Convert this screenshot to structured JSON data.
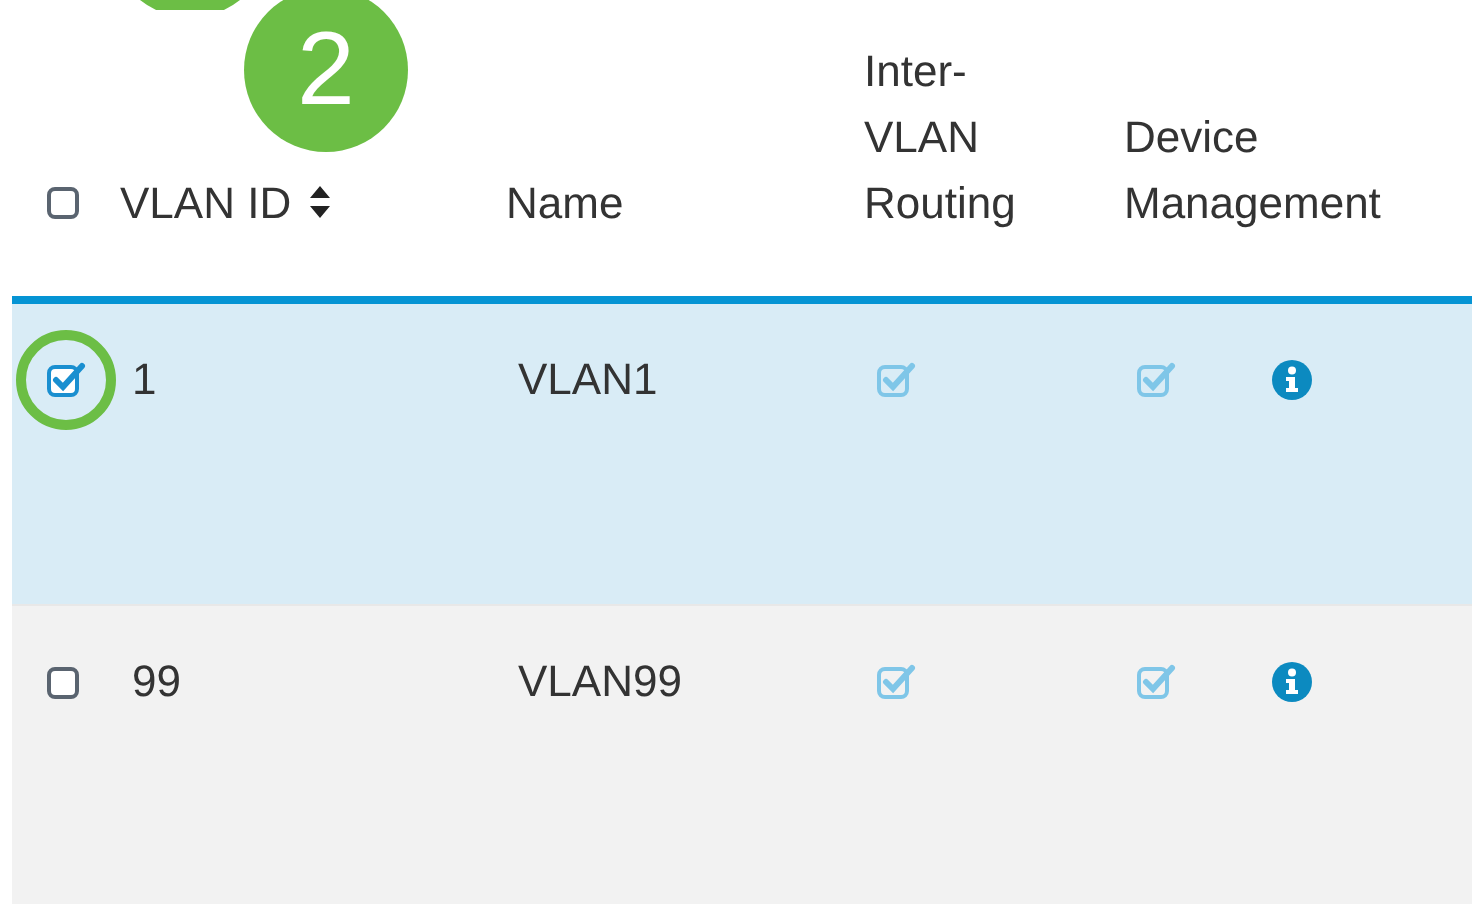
{
  "callouts": [
    {
      "label": "2"
    }
  ],
  "table": {
    "select_all": {
      "checked": false
    },
    "columns": [
      {
        "label": "VLAN ID",
        "sortable": true
      },
      {
        "label": "Name",
        "sortable": false
      },
      {
        "label": "Inter-\nVLAN\nRouting",
        "sortable": false
      },
      {
        "label": "Device\nManagement",
        "sortable": false
      }
    ],
    "rows": [
      {
        "selected": true,
        "highlighted": true,
        "vlan_id": "1",
        "name": "VLAN1",
        "inter_vlan_routing": true,
        "device_management": true
      },
      {
        "selected": false,
        "highlighted": false,
        "vlan_id": "99",
        "name": "VLAN99",
        "inter_vlan_routing": true,
        "device_management": true
      }
    ]
  }
}
